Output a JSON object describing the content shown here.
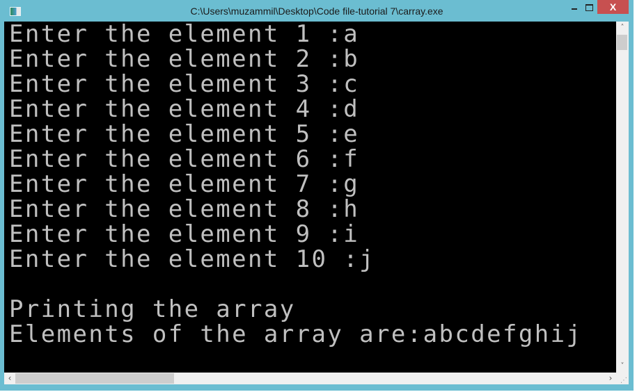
{
  "window": {
    "title": "C:\\Users\\muzammil\\Desktop\\Code file-tutorial 7\\carray.exe",
    "icon": "console-app-icon",
    "controls": {
      "minimize": "minimize",
      "maximize": "maximize",
      "close": "X"
    }
  },
  "console": {
    "lines": [
      "Enter the element 1 :a",
      "Enter the element 2 :b",
      "Enter the element 3 :c",
      "Enter the element 4 :d",
      "Enter the element 5 :e",
      "Enter the element 6 :f",
      "Enter the element 7 :g",
      "Enter the element 8 :h",
      "Enter the element 9 :i",
      "Enter the element 10 :j",
      "",
      "Printing the array",
      "Elements of the array are:abcdefghij"
    ],
    "text_color": "#c0c0c0",
    "background_color": "#000000"
  },
  "scrollbars": {
    "up_arrow": "˄",
    "down_arrow": "˅",
    "left_arrow": "‹",
    "right_arrow": "›"
  },
  "colors": {
    "frame": "#6bbdd1",
    "close_button": "#c75050"
  }
}
